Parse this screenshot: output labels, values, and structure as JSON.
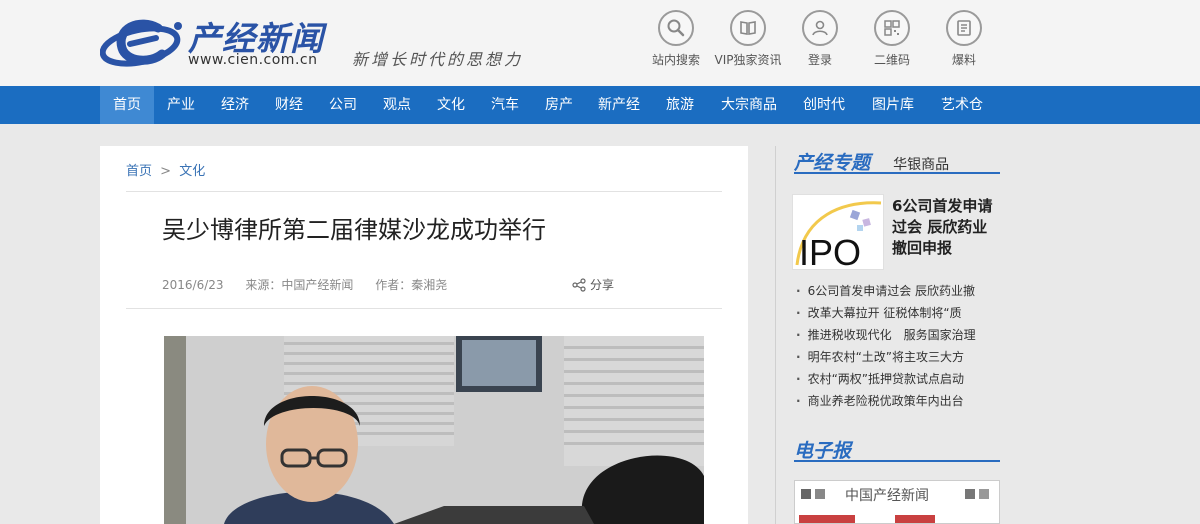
{
  "header": {
    "logo_title": "产经新闻",
    "logo_url": "www.cien.com.cn",
    "slogan": "新增长时代的思想力",
    "tools": [
      {
        "label": "站内搜索",
        "icon": "search-icon"
      },
      {
        "label": "VIP独家资讯",
        "icon": "book-icon"
      },
      {
        "label": "登录",
        "icon": "user-icon"
      },
      {
        "label": "二维码",
        "icon": "qrcode-icon"
      },
      {
        "label": "爆料",
        "icon": "document-icon"
      }
    ]
  },
  "nav": {
    "items": [
      "首页",
      "产业",
      "经济",
      "财经",
      "公司",
      "观点",
      "文化",
      "汽车",
      "房产",
      "新产经",
      "旅游",
      "大宗商品",
      "创时代",
      "图片库",
      "艺术仓"
    ],
    "active_index": 0
  },
  "article": {
    "breadcrumb": [
      "首页",
      ">",
      "文化"
    ],
    "title": "吴少博律所第二届律媒沙龙成功举行",
    "date": "2016/6/23",
    "source": "来源：中国产经新闻",
    "author": "作者：秦湘尧",
    "share_label": "分享"
  },
  "sidebar": {
    "topic_title": "产经专题",
    "topic_sub": "华银商品",
    "feature_image_text": "IPO",
    "feature_text": "6公司首发申请过会 辰欣药业撤回申报",
    "news": [
      "6公司首发申请过会 辰欣药业撤",
      "改革大幕拉开 征税体制将“质",
      "推进税收现代化　服务国家治理",
      "明年农村“土改”将主攻三大方",
      "农村“两权”抵押贷款试点启动",
      "商业养老险税优政策年内出台"
    ],
    "epaper_title": "电子报",
    "epaper_name": "中国产经新闻"
  },
  "colors": {
    "nav_bg": "#1b6dc1",
    "nav_active": "#3f89d3",
    "brand_blue": "#2a53a6",
    "link_blue": "#3a73b5"
  }
}
